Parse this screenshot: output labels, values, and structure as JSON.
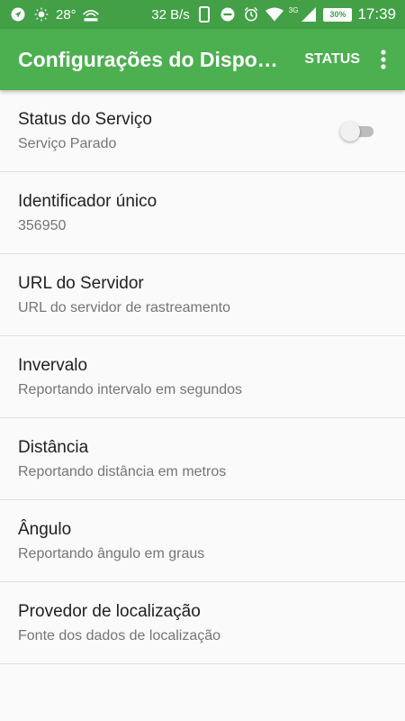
{
  "status_bar": {
    "temperature": "28°",
    "network_speed": "32 B/s",
    "network_type": "3G",
    "battery": "30%",
    "time": "17:39"
  },
  "app_bar": {
    "title": "Configurações do Dispo…",
    "status_button": "STATUS",
    "overflow_icon": "more-vert-icon"
  },
  "preferences": [
    {
      "title": "Status do Serviço",
      "summary": "Serviço Parado",
      "switch": false
    },
    {
      "title": "Identificador único",
      "summary": "356950"
    },
    {
      "title": "URL do Servidor",
      "summary": "URL do servidor de rastreamento"
    },
    {
      "title": "Invervalo",
      "summary": "Reportando intervalo em segundos"
    },
    {
      "title": "Distância",
      "summary": "Reportando distância em metros"
    },
    {
      "title": "Ângulo",
      "summary": "Reportando ângulo em graus"
    },
    {
      "title": "Provedor de localização",
      "summary": "Fonte dos dados de localização"
    }
  ],
  "colors": {
    "status_bar": "#43a047",
    "app_bar": "#4caf50",
    "background": "#fafafa"
  }
}
